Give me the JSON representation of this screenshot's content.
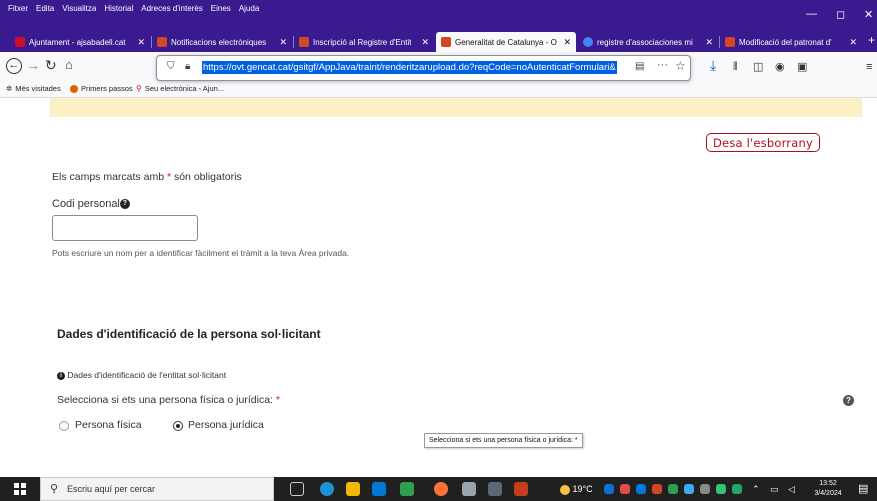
{
  "menubar": {
    "items": [
      "Fitxer",
      "Edita",
      "Visualitza",
      "Historial",
      "Adreces d'interès",
      "Eines",
      "Ajuda"
    ],
    "minimize": "—",
    "maximize": "◻",
    "close": "✕"
  },
  "tabs": [
    {
      "label": "Ajuntament - ajsabadell.cat",
      "close": "✕",
      "color": "#c8102e"
    },
    {
      "label": "Notificacions electròniques",
      "close": "✕",
      "color": "#d24726"
    },
    {
      "label": "Inscripció al Registre d'Entit",
      "close": "✕",
      "color": "#d24726"
    },
    {
      "label": "Generalitat de Catalunya - O",
      "close": "✕",
      "color": "#d24726"
    },
    {
      "label": "registre d'associaciones mi",
      "close": "✕",
      "color": "#4285f4"
    },
    {
      "label": "Modificació del patronat d'",
      "close": "✕",
      "color": "#d24726"
    }
  ],
  "newtab": "+",
  "urlbar": {
    "url": "https://ovt.gencat.cat/gsitgf/AppJava/traint/renderitzarupload.do?reqCode=noAutenticatFormulari&",
    "more": "···",
    "star": "☆"
  },
  "bookmarks": [
    {
      "label": "Més visitades"
    },
    {
      "label": "Primers passos"
    },
    {
      "label": "Seu electrònica - Ajun..."
    }
  ],
  "page": {
    "save_draft": "Desa l'esborrany",
    "required_note_pre": "Els camps marcats amb",
    "required_star": "*",
    "required_note_post": "són obligatoris",
    "code_label": "Codi personal",
    "code_value": "",
    "code_help": "Pots escriure un nom per a identificar fàcilment el tràmit a la teva Àrea privada.",
    "section_title": "Dades d'identificació de la persona sol·licitant",
    "entity_info": "Dades d'identificació de l'entitat sol·licitant",
    "person_type_label": "Selecciona si ets una persona física o jurídica:",
    "person_type_star": "*",
    "option_fisica": "Persona física",
    "option_juridica": "Persona jurídica",
    "selected": "Persona jurídica",
    "tooltip": "Selecciona si ets una persona física o jurídica: *",
    "help_icon": "?"
  },
  "taskbar": {
    "search_placeholder": "Escriu aquí per cercar",
    "weather": "19°C",
    "time": "13:52",
    "date": "3/4/2024"
  }
}
